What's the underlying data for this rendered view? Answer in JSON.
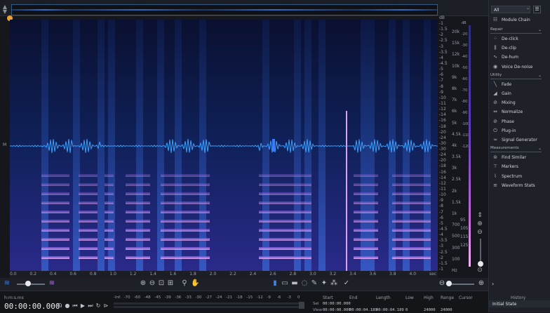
{
  "overview": {
    "scroll_icon": "up-down-arrows-icon"
  },
  "gutter": {
    "label": "M"
  },
  "db_scale": {
    "unit": "dB",
    "ticks": [
      "-1",
      "-1.5",
      "-2",
      "-2.5",
      "-3",
      "-3.5",
      "-4",
      "-4.5",
      "-5",
      "-6",
      "-7",
      "-8",
      "-9",
      "-10",
      "-11",
      "-12",
      "-14",
      "-16",
      "-18",
      "-20",
      "-24",
      "-30",
      "-30",
      "-24",
      "-20",
      "-18",
      "-16",
      "-14",
      "-12",
      "-11",
      "-10",
      "-9",
      "-8",
      "-7",
      "-6",
      "-5",
      "-4.5",
      "-4",
      "-3.5",
      "-3",
      "-2.5",
      "-2",
      "-1.5",
      "-1"
    ]
  },
  "hz_scale": {
    "ticks": [
      "20k",
      "15k",
      "12k",
      "10k",
      "9k",
      "8k",
      "7k",
      "6k",
      "5k",
      "4.5k",
      "4k",
      "3.5k",
      "3k",
      "2.5k",
      "2k",
      "1.5k",
      "1k",
      "700",
      "500",
      "300",
      "100",
      "Hz"
    ],
    "db_right": [
      "dB",
      "-20",
      "-30",
      "-40",
      "-50",
      "-60",
      "-70",
      "-80",
      "-90",
      "-100",
      "-110",
      "-120"
    ],
    "marks": [
      "95",
      "105",
      "115",
      "125"
    ]
  },
  "time_ruler": {
    "ticks": [
      "0.0",
      "0.2",
      "0.4",
      "0.6",
      "0.8",
      "1.0",
      "1.2",
      "1.4",
      "1.6",
      "1.8",
      "2.0",
      "2.2",
      "2.4",
      "2.6",
      "2.8",
      "3.0",
      "3.2",
      "3.4",
      "3.6",
      "3.8",
      "4.0",
      "sec"
    ]
  },
  "toolbar": {
    "left_icons": [
      "waveform-icon",
      "spectrogram-icon"
    ],
    "tools": [
      "zoom-in-icon",
      "zoom-out-icon",
      "zoom-selection-icon",
      "zoom-fit-icon",
      "magnify-icon",
      "hand-icon"
    ],
    "select_tools": [
      "time-select-icon",
      "freq-select-icon",
      "rect-select-icon",
      "lasso-icon",
      "brush-icon",
      "magic-wand-icon",
      "harmonics-icon",
      "instant-process-icon"
    ],
    "zoom_icons": [
      "zoom-out-icon",
      "zoom-in-icon"
    ]
  },
  "transport": {
    "timecode_format": "h:m:s.ms",
    "timecode": "00:00:00.000",
    "buttons": [
      "headphones-icon",
      "record-icon",
      "skip-back-icon",
      "play-icon",
      "skip-forward-icon",
      "loop-icon",
      "play-selection-icon"
    ]
  },
  "meter": {
    "ticks": [
      "-Inf.",
      "-70",
      "-60",
      "-48",
      "-45",
      "-39",
      "-36",
      "-33",
      "-30",
      "-27",
      "-24",
      "-21",
      "-18",
      "-15",
      "-12",
      "-9",
      "-6",
      "-3",
      "0"
    ]
  },
  "selection": {
    "headers": [
      "Start",
      "End",
      "Length",
      "Low",
      "High",
      "Range",
      "Cursor"
    ],
    "sel_label": "Sel",
    "view_label": "View",
    "sel_values": [
      "00:00:00.000",
      "",
      "",
      "",
      "",
      "",
      ""
    ],
    "view_values": [
      "00:00:00.000",
      "00:00:04.189",
      "00:00:04.189",
      "0",
      "24000",
      "24000",
      ""
    ]
  },
  "panel": {
    "filter": "All",
    "menu_icon": "hamburger-icon",
    "module_chain": "Module Chain",
    "sections": [
      {
        "title": "Repair",
        "items": [
          {
            "label": "De-click",
            "icon": "declick-icon"
          },
          {
            "label": "De-clip",
            "icon": "declip-icon"
          },
          {
            "label": "De-hum",
            "icon": "dehum-icon"
          },
          {
            "label": "Voice De-noise",
            "icon": "voice-denoise-icon"
          }
        ]
      },
      {
        "title": "Utility",
        "items": [
          {
            "label": "Fade",
            "icon": "fade-icon"
          },
          {
            "label": "Gain",
            "icon": "gain-icon"
          },
          {
            "label": "Mixing",
            "icon": "mixing-icon"
          },
          {
            "label": "Normalize",
            "icon": "normalize-icon"
          },
          {
            "label": "Phase",
            "icon": "phase-icon"
          },
          {
            "label": "Plug-in",
            "icon": "plugin-icon"
          },
          {
            "label": "Signal Generator",
            "icon": "signal-generator-icon"
          }
        ]
      },
      {
        "title": "Measurements",
        "items": [
          {
            "label": "Find Similar",
            "icon": "find-similar-icon"
          },
          {
            "label": "Markers",
            "icon": "markers-icon"
          },
          {
            "label": "Spectrum",
            "icon": "spectrum-icon"
          },
          {
            "label": "Waveform Stats",
            "icon": "waveform-stats-icon"
          }
        ]
      }
    ],
    "history_title": "History",
    "history_item": "Initial State"
  },
  "colors": {
    "accent": "#4a7fd6",
    "playhead": "#f0a030",
    "waveform": "#3aa0ff",
    "spectro_hot": "#e6a6f0"
  }
}
